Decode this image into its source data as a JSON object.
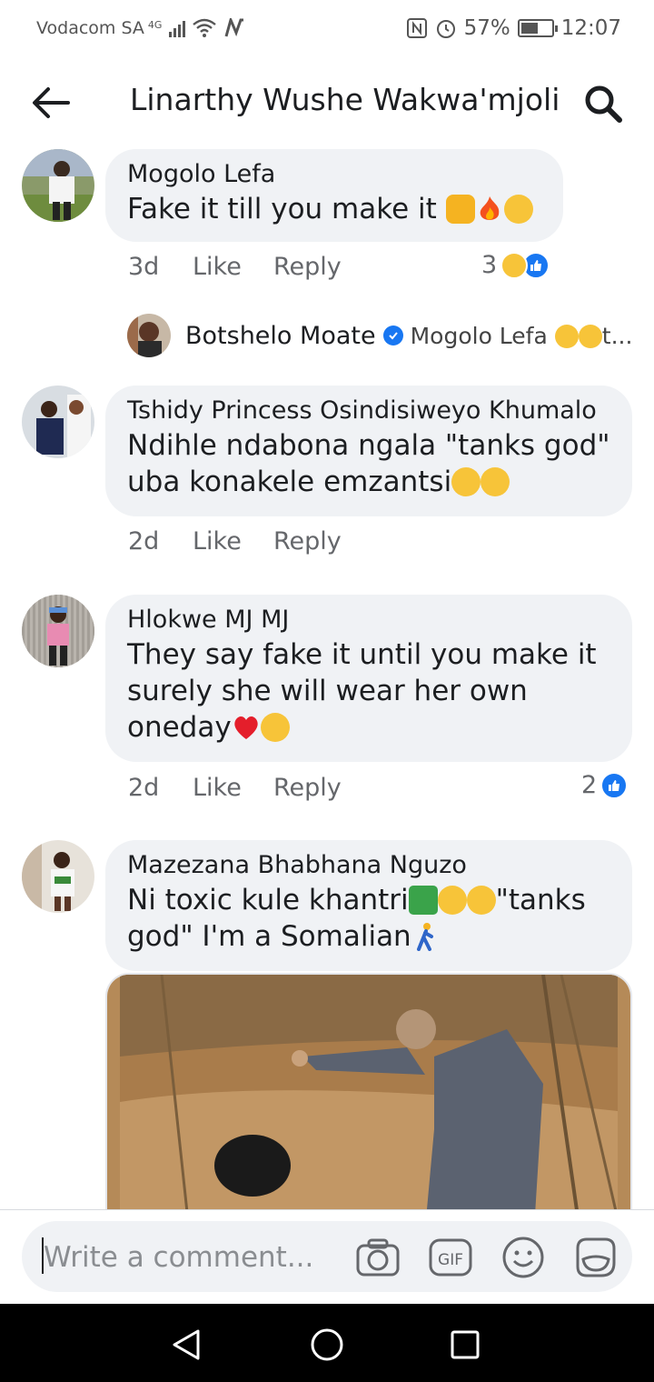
{
  "status": {
    "carrier": "Vodacom SA",
    "network": "4G",
    "battery": "57%",
    "battery_level": 0.57,
    "time": "12:07"
  },
  "header": {
    "title": "Linarthy Wushe Wakwa'mjoli"
  },
  "comments": [
    {
      "name": "Mogolo Lefa",
      "lines": [
        "Fake it till you make it"
      ],
      "time": "3d",
      "like_label": "Like",
      "reply_label": "Reply",
      "reaction_count": "3"
    },
    {
      "name": "Tshidy Princess Osindisiweyo Khumalo",
      "lines": [
        "Ndihle ndabona ngala \"tanks god\"",
        "uba konakele emzantsi"
      ],
      "time": "2d",
      "like_label": "Like",
      "reply_label": "Reply"
    },
    {
      "name": "Hlokwe MJ MJ",
      "lines": [
        "They say fake it until you make it",
        "surely she will wear her own",
        "oneday"
      ],
      "time": "2d",
      "like_label": "Like",
      "reply_label": "Reply",
      "reaction_count": "2"
    },
    {
      "name": "Mazezana Bhabhana Nguzo",
      "lines": [
        "Ni toxic kule khantri",
        "\"tanks",
        "god\" I'm a Somalian"
      ]
    }
  ],
  "reply": {
    "name": "Botshelo Moate",
    "preview": "Mogolo Lefa",
    "preview_tail": "t..."
  },
  "compose": {
    "placeholder": "Write a comment...",
    "gif_label": "GIF"
  },
  "colors": {
    "accent": "#1877f2",
    "bubble": "#f0f2f5",
    "meta_text": "#65676b"
  },
  "icons": [
    "back-arrow-icon",
    "search-icon",
    "camera-icon",
    "gif-icon",
    "emoji-icon",
    "sticker-icon",
    "nav-back-icon",
    "nav-home-icon",
    "nav-recents-icon"
  ]
}
